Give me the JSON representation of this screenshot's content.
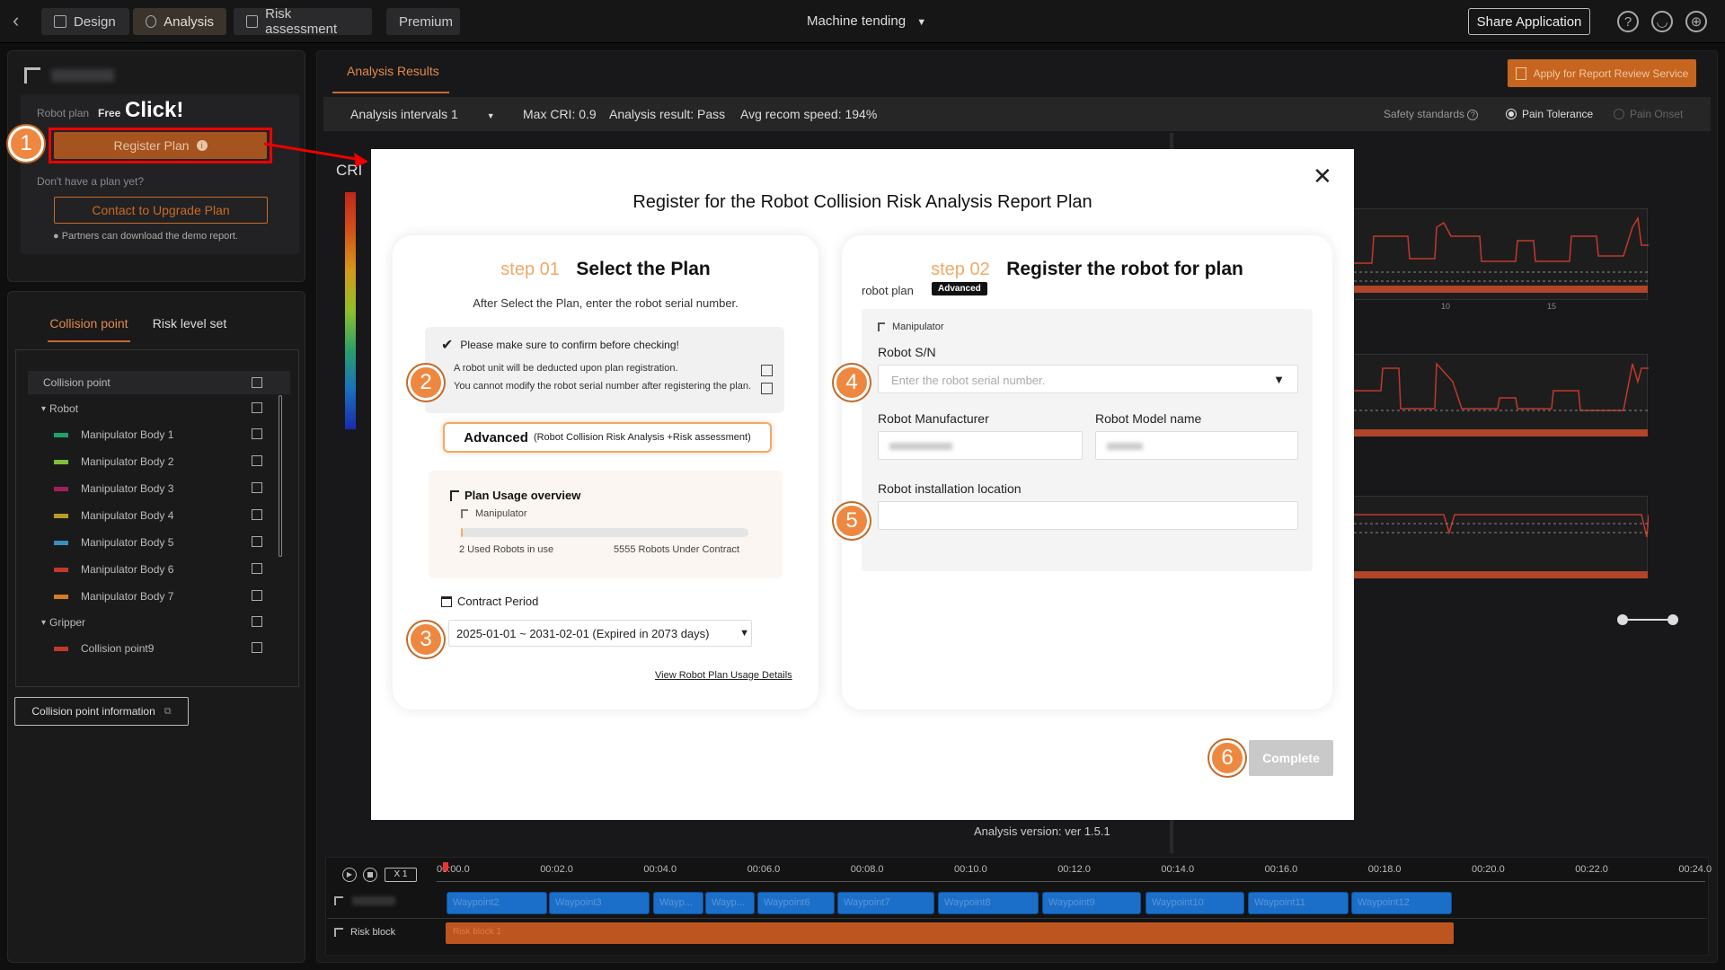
{
  "topbar": {
    "tabs": [
      {
        "label": "Design"
      },
      {
        "label": "Analysis"
      },
      {
        "label": "Risk assessment"
      },
      {
        "label": "Premium"
      }
    ],
    "project": "Machine tending",
    "share": "Share Application"
  },
  "left": {
    "robot_plan_label": "Robot plan",
    "robot_plan_value": "Free",
    "click_label": "Click!",
    "register_btn": "Register Plan",
    "no_plan": "Don't have a plan yet?",
    "contact_btn": "Contact to Upgrade Plan",
    "partners_note": "Partners can download the demo report.",
    "tabs": [
      "Collision point",
      "Risk level set"
    ],
    "tree_header": "Collision point",
    "tree": [
      {
        "label": "Robot",
        "group": true
      },
      {
        "label": "Manipulator Body 1",
        "color": "#1fa06a"
      },
      {
        "label": "Manipulator Body 2",
        "color": "#7fbf3a"
      },
      {
        "label": "Manipulator Body 3",
        "color": "#a01f5a"
      },
      {
        "label": "Manipulator Body 4",
        "color": "#b89a2a"
      },
      {
        "label": "Manipulator Body 5",
        "color": "#3a8fbf"
      },
      {
        "label": "Manipulator Body 6",
        "color": "#c0392b"
      },
      {
        "label": "Manipulator Body 7",
        "color": "#d47a2a"
      },
      {
        "label": "Gripper",
        "group": true
      },
      {
        "label": "Collision point9",
        "color": "#c0392b"
      }
    ],
    "info_btn": "Collision point information"
  },
  "main": {
    "tab": "Analysis Results",
    "apply_btn": "Apply for Report Review Service",
    "interval": "Analysis intervals 1",
    "max_cri": "Max CRI: 0.9",
    "result": "Analysis result: Pass",
    "avg_speed": "Avg recom speed: 194%",
    "safety": "Safety standards",
    "pain_tol": "Pain Tolerance",
    "pain_onset": "Pain Onset",
    "cri_label": "CRI",
    "version": "Analysis version: ver 1.5.1",
    "x_ticks": [
      "10",
      "15"
    ]
  },
  "timeline": {
    "speed": "X 1",
    "ticks": [
      "00:00.0",
      "00:02.0",
      "00:04.0",
      "00:06.0",
      "00:08.0",
      "00:10.0",
      "00:12.0",
      "00:14.0",
      "00:16.0",
      "00:18.0",
      "00:20.0",
      "00:22.0",
      "00:24.0"
    ],
    "waypoints": [
      "Waypoint2",
      "Waypoint3",
      "Wayp...",
      "Wayp...",
      "Waypoint6",
      "Waypoint7",
      "Waypoint8",
      "Waypoint9",
      "Waypoint10",
      "Waypoint11",
      "Waypoint12"
    ],
    "risk_row_label": "Risk block",
    "risk_block": "Risk block 1"
  },
  "modal": {
    "title": "Register for the Robot Collision Risk Analysis Report Plan",
    "step1": {
      "num": "step 01",
      "title": "Select the Plan",
      "subtitle": "After Select the Plan, enter the robot serial number.",
      "confirm_title": "Please make sure to confirm before checking!",
      "check1": "A robot unit will be deducted upon plan registration.",
      "check2": "You cannot modify the robot serial number after registering the plan.",
      "plan_name": "Advanced",
      "plan_desc": "(Robot Collision Risk Analysis +Risk assessment)",
      "usage_title": "Plan Usage overview",
      "usage_type": "Manipulator",
      "used": "2 Used Robots in use",
      "contract": "5555 Robots Under Contract",
      "usage_fraction": 0.0004,
      "period_label": "Contract Period",
      "period_value": "2025-01-01 ~ 2031-02-01 (Expired in 2073 days)",
      "details_link": "View Robot Plan Usage Details"
    },
    "step2": {
      "num": "step 02",
      "title": "Register the robot for plan",
      "robot_plan": "robot plan",
      "badge": "Advanced",
      "type": "Manipulator",
      "sn_label": "Robot S/N",
      "sn_placeholder": "Enter the robot serial number.",
      "manufacturer_label": "Robot Manufacturer",
      "model_label": "Robot Model name",
      "location_label": "Robot installation location"
    },
    "complete": "Complete",
    "badges": [
      "1",
      "2",
      "3",
      "4",
      "5",
      "6"
    ]
  }
}
